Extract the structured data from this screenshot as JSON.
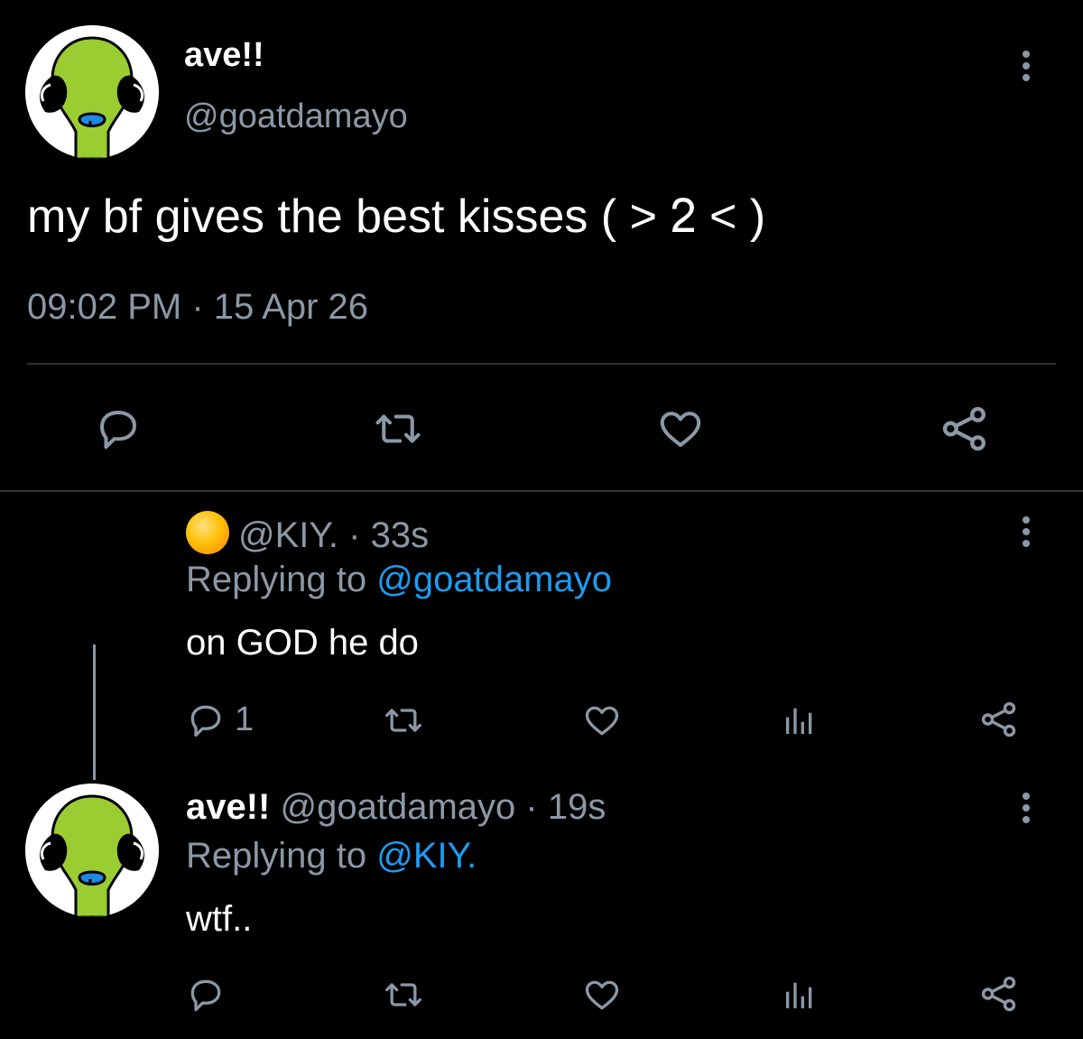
{
  "main_tweet": {
    "display_name": "ave!!",
    "handle": "@goatdamayo",
    "text": "my bf gives the best kisses ( > ᒿ < )",
    "time": "09:02 PM",
    "separator": "·",
    "date": "15 Apr 26",
    "actions": [
      "reply-icon",
      "retweet-icon",
      "like-icon",
      "share-icon"
    ]
  },
  "replies": [
    {
      "handle": "@KIY.",
      "separator": " · ",
      "time": "33s",
      "replying_prefix": "Replying to ",
      "replying_to": "@goatdamayo",
      "text": "on GOD he do",
      "reply_count": "1"
    },
    {
      "display_name": "ave!!",
      "handle": "@goatdamayo",
      "separator": " · ",
      "time": "19s",
      "replying_prefix": "Replying to ",
      "replying_to": "@KIY.",
      "text": "wtf..",
      "reply_count": ""
    }
  ],
  "colors": {
    "background": "#000000",
    "muted": "#8b98a5",
    "link": "#1d9bf0",
    "avatar_green": "#9acd32"
  }
}
